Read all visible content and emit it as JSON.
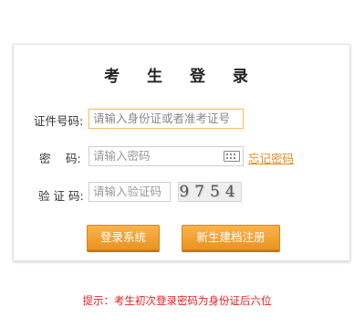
{
  "login": {
    "title": "考 生 登 录",
    "id_label": "证件号码:",
    "id_placeholder": "请输入身份证或者准考证号",
    "pwd_label": "密　 码:",
    "pwd_placeholder": "请输入密码",
    "keyboard_icon": "keyboard-icon",
    "forgot_link": "忘记密码",
    "captcha_label": "验 证 码:",
    "captcha_placeholder": "请输入验证码",
    "captcha_text": "9754",
    "login_button": "登录系统",
    "register_button": "新生建档注册"
  },
  "tip": "提示：考生初次登录密码为身份证后六位",
  "colors": {
    "accent": "#f0a234",
    "link": "#e08a1e",
    "tip": "#e02020"
  }
}
